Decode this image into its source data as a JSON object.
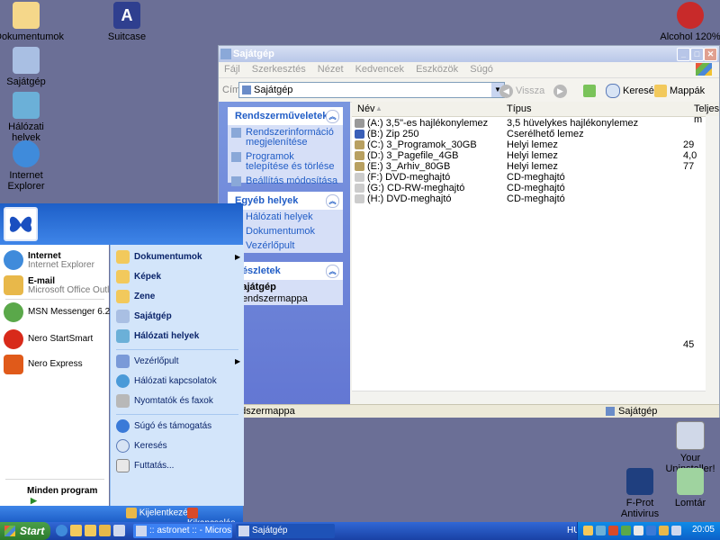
{
  "desktop": {
    "icons": [
      {
        "label": "Dokumentumok"
      },
      {
        "label": "Suitcase"
      },
      {
        "label": "Sajátgép"
      },
      {
        "label": "Hálózati helyek"
      },
      {
        "label": "Internet Explorer"
      },
      {
        "label": "Alcohol 120%"
      },
      {
        "label": "Your Uninstaller!"
      },
      {
        "label": "F-Prot Antivirus"
      },
      {
        "label": "Lomtár"
      }
    ]
  },
  "window": {
    "title": "Sajátgép",
    "menu": [
      "Fájl",
      "Szerkesztés",
      "Nézet",
      "Kedvencek",
      "Eszközök",
      "Súgó"
    ],
    "address_label": "Cím",
    "address_value": "Sajátgép",
    "back_label": "Vissza",
    "search_label": "Keresés",
    "folders_label": "Mappák",
    "tasks": {
      "system": {
        "title": "Rendszerműveletek",
        "items": [
          "Rendszerinformáció megjelenítése",
          "Programok telepítése és törlése",
          "Beállítás módosítása"
        ]
      },
      "other": {
        "title": "Egyéb helyek",
        "items": [
          "Hálózati helyek",
          "Dokumentumok",
          "Vezérlőpult"
        ]
      },
      "details": {
        "title": "Részletek",
        "name": "Sajátgép",
        "desc": "Rendszermappa"
      }
    },
    "columns": {
      "name": "Név",
      "type": "Típus",
      "size": "Teljes m"
    },
    "files": [
      {
        "name": "(A:) 3,5\"-es hajlékonylemez",
        "type": "3,5 hüvelykes hajlékonylemez",
        "size": ""
      },
      {
        "name": "(B:) Zip 250",
        "type": "Cserélhető lemez",
        "size": ""
      },
      {
        "name": "(C:) 3_Programok_30GB",
        "type": "Helyi lemez",
        "size": "29"
      },
      {
        "name": "(D:) 3_Pagefile_4GB",
        "type": "Helyi lemez",
        "size": "4,0"
      },
      {
        "name": "(E:) 3_Arhiv_80GB",
        "type": "Helyi lemez",
        "size": "77"
      },
      {
        "name": "(F:) DVD-meghajtó",
        "type": "CD-meghajtó",
        "size": ""
      },
      {
        "name": "(G:) CD-RW-meghajtó",
        "type": "CD-meghajtó",
        "size": ""
      },
      {
        "name": "(H:) DVD-meghajtó",
        "type": "CD-meghajtó",
        "size": ""
      }
    ],
    "extra_value": "45",
    "status_left": "Rendszermappa",
    "status_right": "Sajátgép"
  },
  "startmenu": {
    "pinned": [
      {
        "title": "Internet",
        "sub": "Internet Explorer"
      },
      {
        "title": "E-mail",
        "sub": "Microsoft Office Outlook"
      }
    ],
    "recent": [
      "MSN Messenger 6.2",
      "Nero StartSmart",
      "Nero Express"
    ],
    "all_programs": "Minden program",
    "right": [
      "Dokumentumok",
      "Képek",
      "Zene",
      "Sajátgép",
      "Hálózati helyek",
      "Vezérlőpult",
      "Hálózati kapcsolatok",
      "Nyomtatók és faxok",
      "Súgó és támogatás",
      "Keresés",
      "Futtatás..."
    ],
    "logoff": "Kijelentkezés",
    "shutdown": "Kikapcsolás"
  },
  "taskbar": {
    "start": "Start",
    "buttons": [
      ":: astronet :: - Micros...",
      "Sajátgép"
    ],
    "lang": "HU",
    "clock": "20:05"
  }
}
